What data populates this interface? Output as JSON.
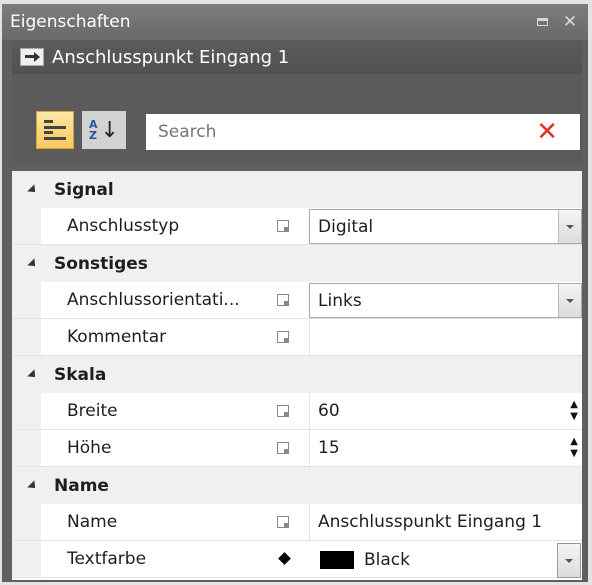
{
  "window": {
    "title": "Eigenschaften"
  },
  "object": {
    "name": "Anschlusspunkt Eingang 1"
  },
  "toolbar": {
    "categorized_icon": "categorized-icon",
    "sort_icon": "alphabetical-sort-icon",
    "search_placeholder": "Search"
  },
  "categories": [
    {
      "label": "Signal"
    },
    {
      "label": "Sonstiges"
    },
    {
      "label": "Skala"
    },
    {
      "label": "Name"
    }
  ],
  "properties": {
    "anschlusstyp": {
      "name": "Anschlusstyp",
      "value": "Digital"
    },
    "anschlussorientierung": {
      "name": "Anschlussorientati...",
      "value": "Links"
    },
    "kommentar": {
      "name": "Kommentar",
      "value": ""
    },
    "breite": {
      "name": "Breite",
      "value": "60"
    },
    "hoehe": {
      "name": "Höhe",
      "value": "15"
    },
    "name": {
      "name": "Name",
      "value": "Anschlusspunkt Eingang 1"
    },
    "textfarbe": {
      "name": "Textfarbe",
      "value": "Black",
      "color": "#000000"
    }
  },
  "colors": {
    "accent": "#f9c95a",
    "clear": "#e0332f"
  }
}
